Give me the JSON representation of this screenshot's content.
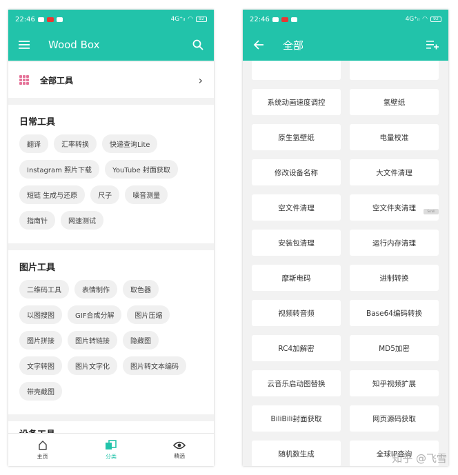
{
  "status": {
    "time": "22:46",
    "signal": "4G⁺ᵢₗ",
    "battery": "92"
  },
  "left": {
    "title": "Wood Box",
    "all_tools": "全部工具",
    "sections": [
      {
        "title": "日常工具",
        "chips": [
          "翻译",
          "汇率转换",
          "快递查询Lite",
          "Instagram 照片下载",
          "YouTube 封面获取",
          "短链 生成与还原",
          "尺子",
          "噪音测量",
          "指南针",
          "网速测试"
        ]
      },
      {
        "title": "图片工具",
        "chips": [
          "二维码工具",
          "表情制作",
          "取色器",
          "以图搜图",
          "GIF合成分解",
          "图片压缩",
          "图片拼接",
          "图片转链接",
          "隐藏图",
          "文字转图",
          "图片文字化",
          "图片转文本编码",
          "带壳截图"
        ]
      },
      {
        "title": "设备工具",
        "chips": []
      }
    ],
    "nav": [
      {
        "label": "主页",
        "icon": "home-icon"
      },
      {
        "label": "分类",
        "icon": "category-icon"
      },
      {
        "label": "精选",
        "icon": "eye-icon"
      }
    ]
  },
  "right": {
    "title": "全部",
    "tools": [
      "系统动画速度调控",
      "氢壁纸",
      "原生氢壁纸",
      "电量校准",
      "修改设备名称",
      "大文件清理",
      "空文件清理",
      "空文件夹清理",
      "安装包清理",
      "运行内存清理",
      "摩斯电码",
      "进制转换",
      "视频转音频",
      "Base64编码转换",
      "RC4加解密",
      "MD5加密",
      "云音乐启动图替换",
      "知乎视频扩展",
      "BiliBili封面获取",
      "网页源码获取",
      "随机数生成",
      "全球IP查询"
    ],
    "scroll_label": "Scroll"
  },
  "watermark": "知乎 @飞雪",
  "colors": {
    "accent": "#22c3aa",
    "grid_icon": "#e57399"
  }
}
